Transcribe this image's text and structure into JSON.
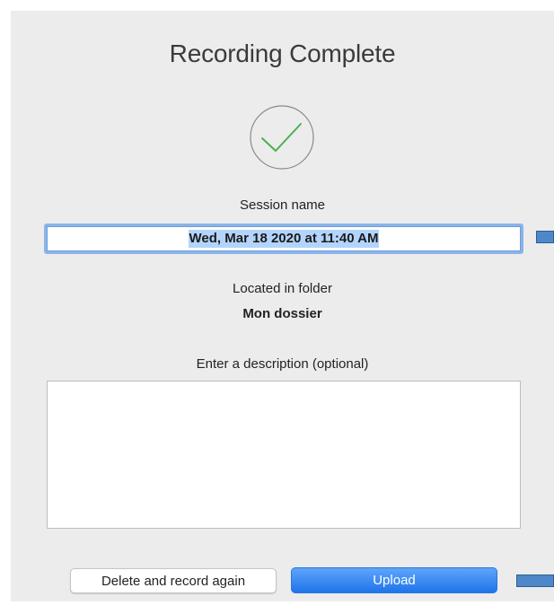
{
  "dialog": {
    "title": "Recording Complete",
    "status_icon": "checkmark-circle-icon",
    "check_color": "#4caf50"
  },
  "session": {
    "label": "Session name",
    "value": "Wed, Mar 18 2020 at 11:40 AM"
  },
  "folder": {
    "label": "Located in folder",
    "name": "Mon dossier"
  },
  "description": {
    "label": "Enter a description (optional)",
    "value": ""
  },
  "buttons": {
    "delete_label": "Delete and record again",
    "upload_label": "Upload"
  },
  "colors": {
    "accent": "#1f74ea",
    "focus_ring": "#8ab4ea",
    "selection": "#b3d4fc",
    "marker": "#4e88c8"
  }
}
